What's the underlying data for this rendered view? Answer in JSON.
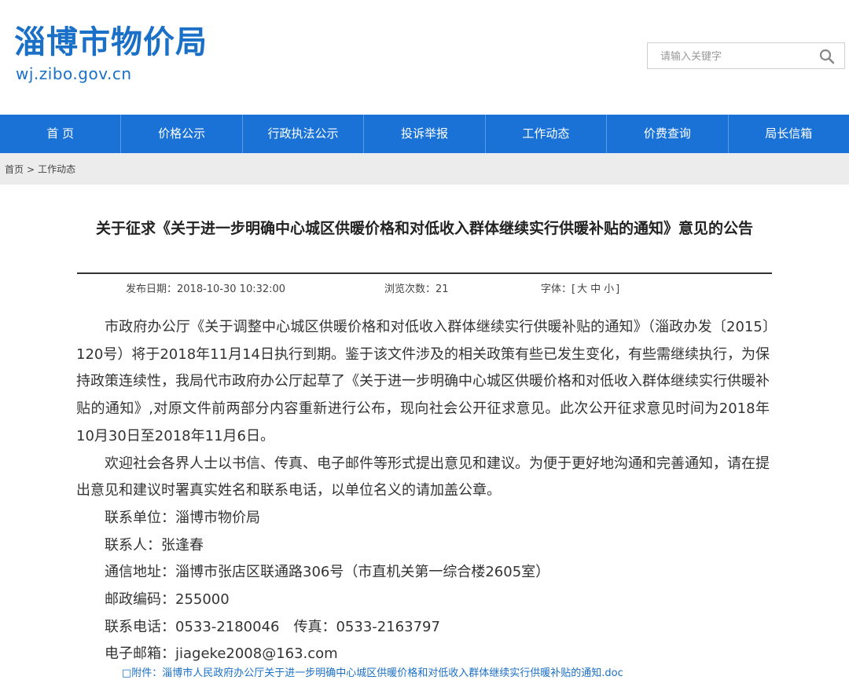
{
  "site": {
    "title": "淄博市物价局",
    "domain": "wj.zibo.gov.cn",
    "brand_color": "#1a6fc7",
    "nav_color": "#1a72d6"
  },
  "search": {
    "placeholder": "请输入关键字",
    "icon": "search-icon"
  },
  "nav": {
    "items": [
      {
        "label": "首 页"
      },
      {
        "label": "价格公示"
      },
      {
        "label": "行政执法公示"
      },
      {
        "label": "投诉举报"
      },
      {
        "label": "工作动态"
      },
      {
        "label": "价费查询"
      },
      {
        "label": "局长信箱"
      }
    ]
  },
  "breadcrumb": {
    "home": "首页",
    "separator": ">",
    "current": "工作动态"
  },
  "article": {
    "title": "关于征求《关于进一步明确中心城区供暖价格和对低收入群体继续实行供暖补贴的通知》意见的公告",
    "meta": {
      "date": "发布日期：2018-10-30 10:32:00",
      "views": "浏览次数：21",
      "font_label": "字体：[",
      "font_large": "大",
      "font_medium": "中",
      "font_small": "小",
      "font_close": "]"
    },
    "paragraphs": [
      "市政府办公厅《关于调整中心城区供暖价格和对低收入群体继续实行供暖补贴的通知》（淄政办发〔2015〕120号）将于2018年11月14日执行到期。鉴于该文件涉及的相关政策有些已发生变化，有些需继续执行，为保持政策连续性，我局代市政府办公厅起草了《关于进一步明确中心城区供暖价格和对低收入群体继续实行供暖补贴的通知》,对原文件前两部分内容重新进行公布，现向社会公开征求意见。此次公开征求意见时间为2018年10月30日至2018年11月6日。",
      "欢迎社会各界人士以书信、传真、电子邮件等形式提出意见和建议。为便于更好地沟通和完善通知，请在提出意见和建议时署真实姓名和联系电话，以单位名义的请加盖公章。"
    ],
    "contact": {
      "unit": "联系单位：淄博市物价局",
      "person": "联系人：张逢春",
      "address": "通信地址：淄博市张店区联通路306号（市直机关第一综合楼2605室）",
      "postcode": "邮政编码：255000",
      "phone": "联系电话：0533-2180046　传真：0533-2163797",
      "email": "电子邮箱：jiageke2008@163.com"
    },
    "attachment": "□附件：淄博市人民政府办公厅关于进一步明确中心城区供暖价格和对低收入群体继续实行供暖补贴的通知.doc"
  }
}
